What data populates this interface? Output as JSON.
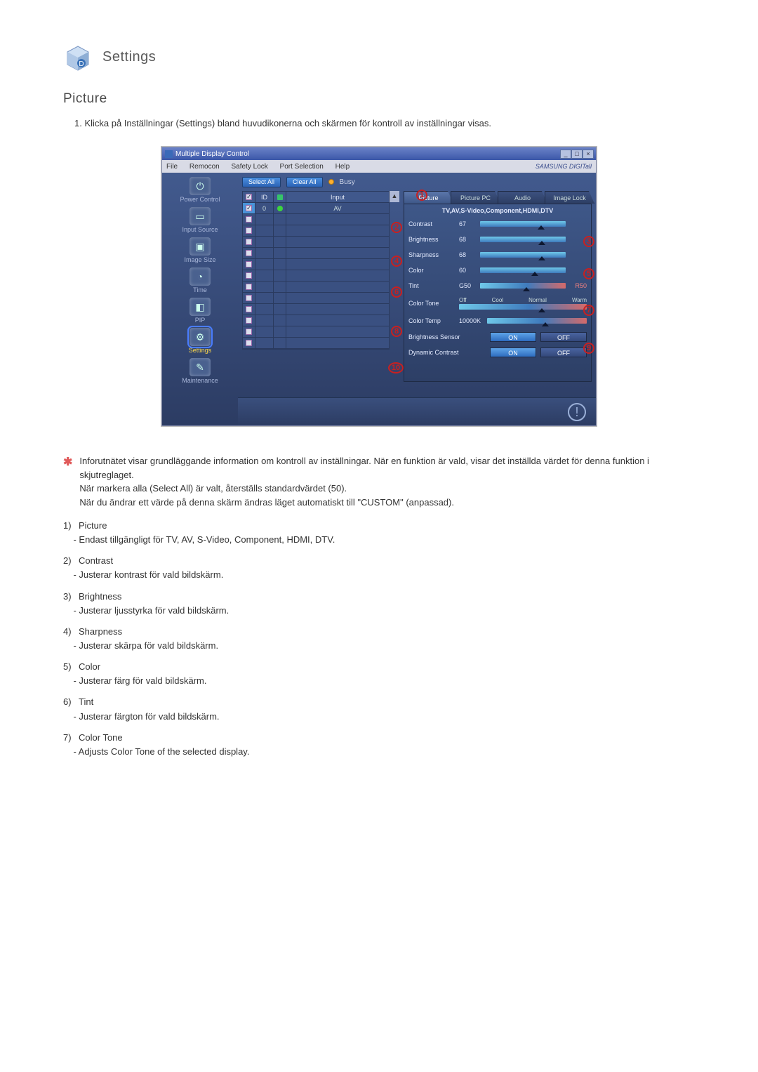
{
  "page": {
    "heading": "Settings",
    "subheading": "Picture",
    "intro": "1. Klicka på Inställningar (Settings) bland huvudikonerna och skärmen för kontroll av inställningar visas."
  },
  "window": {
    "title": "Multiple Display Control",
    "win_min": "_",
    "win_max": "□",
    "win_close": "×",
    "brand": "SAMSUNG DIGITall",
    "menu": {
      "file": "File",
      "remocon": "Remocon",
      "safety": "Safety Lock",
      "port": "Port Selection",
      "help": "Help"
    }
  },
  "sidebar": {
    "items": [
      {
        "label": "Power Control",
        "glyph": "⏻"
      },
      {
        "label": "Input Source",
        "glyph": "▭"
      },
      {
        "label": "Image Size",
        "glyph": "▣"
      },
      {
        "label": "Time",
        "glyph": "◔"
      },
      {
        "label": "PIP",
        "glyph": "◧"
      },
      {
        "label": "Settings",
        "glyph": "⚙"
      },
      {
        "label": "Maintenance",
        "glyph": "✎"
      }
    ]
  },
  "toolbar": {
    "select_all": "Select All",
    "clear_all": "Clear All",
    "busy_label": "Busy"
  },
  "grid": {
    "head": {
      "chk": "☑",
      "id": "ID",
      "status": "",
      "input": "Input"
    },
    "row0": {
      "id": "0",
      "input": "AV"
    }
  },
  "tabs": [
    {
      "label": "Picture"
    },
    {
      "label": "Picture PC"
    },
    {
      "label": "Audio"
    },
    {
      "label": "Image Lock"
    }
  ],
  "panel": {
    "sub_header": "TV,AV,S-Video,Component,HDMI,DTV",
    "contrast": {
      "label": "Contrast",
      "value": "67"
    },
    "brightness": {
      "label": "Brightness",
      "value": "68"
    },
    "sharpness": {
      "label": "Sharpness",
      "value": "68"
    },
    "color": {
      "label": "Color",
      "value": "60"
    },
    "tint": {
      "label": "Tint",
      "left": "G50",
      "right": "R50"
    },
    "color_tone": {
      "label": "Color Tone",
      "o_off": "Off",
      "o_cool": "Cool",
      "o_normal": "Normal",
      "o_warm": "Warm"
    },
    "color_temp": {
      "label": "Color Temp",
      "value": "10000K"
    },
    "brightness_sensor": {
      "label": "Brightness Sensor",
      "on": "ON",
      "off": "OFF"
    },
    "dynamic_contrast": {
      "label": "Dynamic Contrast",
      "on": "ON",
      "off": "OFF"
    }
  },
  "callouts": {
    "c1": "1",
    "c2": "2",
    "c3": "3",
    "c4": "4",
    "c5": "5",
    "c6": "6",
    "c7": "7",
    "c8": "8",
    "c9": "9",
    "c10": "10"
  },
  "note": {
    "l1": "Inforutnätet visar grundläggande information om kontroll av inställningar. När en funktion är vald, visar det inställda värdet för denna funktion i skjutreglaget.",
    "l2": "När markera alla (Select All) är valt, återställs standardvärdet (50).",
    "l3": "När du ändrar ett värde på denna skärm ändras läget automatiskt till \"CUSTOM\" (anpassad)."
  },
  "list": [
    {
      "num": "1)",
      "title": "Picture",
      "desc": "- Endast tillgängligt för TV, AV, S-Video, Component, HDMI, DTV."
    },
    {
      "num": "2)",
      "title": "Contrast",
      "desc": "- Justerar kontrast för vald bildskärm."
    },
    {
      "num": "3)",
      "title": "Brightness",
      "desc": "- Justerar ljusstyrka för vald bildskärm."
    },
    {
      "num": "4)",
      "title": "Sharpness",
      "desc": "- Justerar skärpa för vald bildskärm."
    },
    {
      "num": "5)",
      "title": "Color",
      "desc": "- Justerar färg för vald bildskärm."
    },
    {
      "num": "6)",
      "title": "Tint",
      "desc": "- Justerar färgton för vald bildskärm."
    },
    {
      "num": "7)",
      "title": "Color Tone",
      "desc": "- Adjusts Color Tone of the selected display."
    }
  ]
}
